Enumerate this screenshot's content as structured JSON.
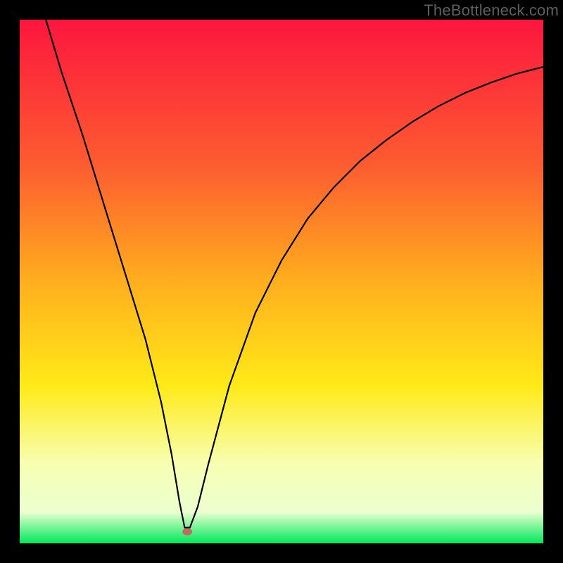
{
  "watermark": "TheBottleneck.com",
  "chart_data": {
    "type": "line",
    "title": "",
    "xlabel": "",
    "ylabel": "",
    "xlim": [
      0,
      100
    ],
    "ylim": [
      0,
      100
    ],
    "grid": false,
    "legend": false,
    "background": {
      "gradient": [
        "#fc163e",
        "#fe8228",
        "#ffea18",
        "#f7ffb3",
        "#00e85c"
      ],
      "borders": "#000000"
    },
    "series": [
      {
        "name": "bottleneck-curve",
        "color": "#000000",
        "x": [
          5,
          8,
          12,
          16,
          20,
          24,
          27,
          29,
          30.5,
          31.5,
          32.5,
          34,
          36,
          40,
          45,
          50,
          55,
          60,
          65,
          70,
          75,
          80,
          85,
          90,
          95,
          100
        ],
        "y": [
          100,
          90,
          78,
          65,
          52,
          39,
          27,
          17,
          8,
          3,
          3,
          7,
          15,
          30,
          44,
          54,
          62,
          68,
          73,
          77,
          80.5,
          83.5,
          86,
          88,
          89.7,
          91
        ]
      }
    ],
    "marker": {
      "name": "optimal-point",
      "x": 32,
      "y": 2.2,
      "color": "#c46a5e",
      "rx": 7,
      "ry": 5
    }
  }
}
